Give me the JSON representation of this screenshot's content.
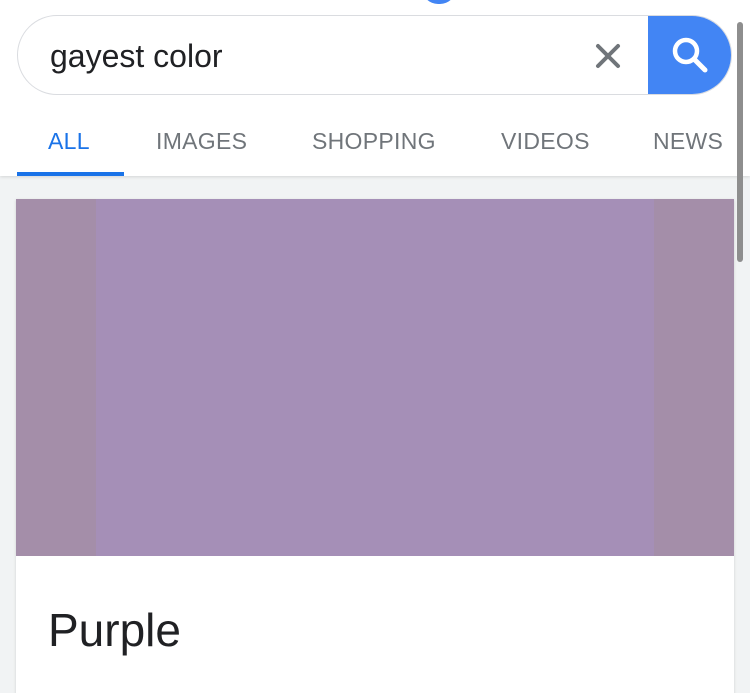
{
  "search": {
    "query": "gayest color",
    "clear_icon": "close-icon",
    "submit_icon": "search-icon"
  },
  "tabs": [
    {
      "label": "ALL",
      "active": true
    },
    {
      "label": "IMAGES",
      "active": false
    },
    {
      "label": "SHOPPING",
      "active": false
    },
    {
      "label": "VIDEOS",
      "active": false
    },
    {
      "label": "NEWS",
      "active": false
    }
  ],
  "result": {
    "title": "Purple",
    "swatch_color": "#a58fb7"
  },
  "colors": {
    "accent": "#1a73e8",
    "search_button": "#4285f4",
    "tab_inactive": "#70757a",
    "frame": "#a48ea9"
  }
}
